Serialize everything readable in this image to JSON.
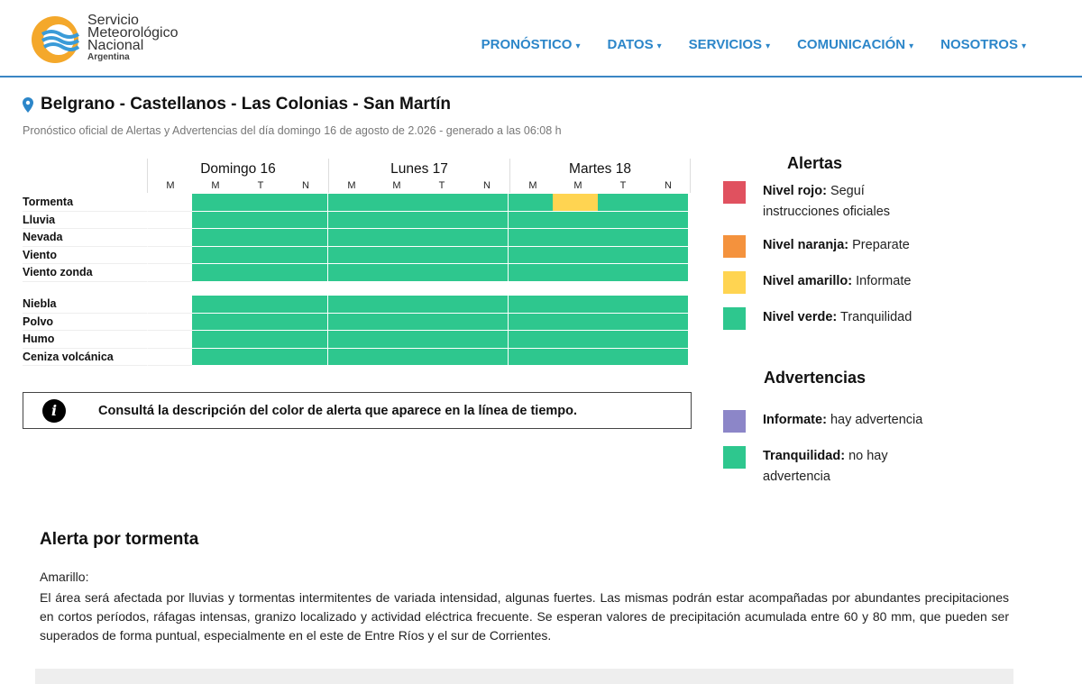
{
  "brand": {
    "line1": "Servicio",
    "line2": "Meteorológico",
    "line3": "Nacional",
    "line4": "Argentina",
    "colors": {
      "orange": "#f4a82b",
      "blue": "#3a9bd8"
    }
  },
  "nav": [
    {
      "label": "PRONÓSTICO",
      "caret": "▾"
    },
    {
      "label": "DATOS",
      "caret": "▾"
    },
    {
      "label": "SERVICIOS",
      "caret": "▾"
    },
    {
      "label": "COMUNICACIÓN",
      "caret": "▾"
    },
    {
      "label": "NOSOTROS",
      "caret": "▾"
    }
  ],
  "location": {
    "icon": "map-pin-icon",
    "title": "Belgrano - Castellanos - Las Colonias - San Martín",
    "subtitle": "Pronóstico oficial de Alertas y Advertencias del día domingo 16 de agosto de 2.026 - generado a las 06:08 h"
  },
  "timeline": {
    "days": [
      {
        "name": "Domingo 16",
        "periods": [
          "M",
          "M",
          "T",
          "N"
        ]
      },
      {
        "name": "Lunes 17",
        "periods": [
          "M",
          "M",
          "T",
          "N"
        ]
      },
      {
        "name": "Martes 18",
        "periods": [
          "M",
          "M",
          "T",
          "N"
        ]
      }
    ],
    "alert_rows": [
      {
        "label": "Tormenta",
        "levels": [
          "none",
          "verde",
          "verde",
          "verde",
          "verde",
          "verde",
          "verde",
          "verde",
          "verde",
          "amarillo",
          "verde",
          "verde"
        ]
      },
      {
        "label": "Lluvia",
        "levels": [
          "none",
          "verde",
          "verde",
          "verde",
          "verde",
          "verde",
          "verde",
          "verde",
          "verde",
          "verde",
          "verde",
          "verde"
        ]
      },
      {
        "label": "Nevada",
        "levels": [
          "none",
          "verde",
          "verde",
          "verde",
          "verde",
          "verde",
          "verde",
          "verde",
          "verde",
          "verde",
          "verde",
          "verde"
        ]
      },
      {
        "label": "Viento",
        "levels": [
          "none",
          "verde",
          "verde",
          "verde",
          "verde",
          "verde",
          "verde",
          "verde",
          "verde",
          "verde",
          "verde",
          "verde"
        ]
      },
      {
        "label": "Viento zonda",
        "levels": [
          "none",
          "verde",
          "verde",
          "verde",
          "verde",
          "verde",
          "verde",
          "verde",
          "verde",
          "verde",
          "verde",
          "verde"
        ]
      }
    ],
    "warning_rows": [
      {
        "label": "Niebla",
        "levels": [
          "none",
          "verde",
          "verde",
          "verde",
          "verde",
          "verde",
          "verde",
          "verde",
          "verde",
          "verde",
          "verde",
          "verde"
        ]
      },
      {
        "label": "Polvo",
        "levels": [
          "none",
          "verde",
          "verde",
          "verde",
          "verde",
          "verde",
          "verde",
          "verde",
          "verde",
          "verde",
          "verde",
          "verde"
        ]
      },
      {
        "label": "Humo",
        "levels": [
          "none",
          "verde",
          "verde",
          "verde",
          "verde",
          "verde",
          "verde",
          "verde",
          "verde",
          "verde",
          "verde",
          "verde"
        ]
      },
      {
        "label": "Ceniza volcánica",
        "levels": [
          "none",
          "verde",
          "verde",
          "verde",
          "verde",
          "verde",
          "verde",
          "verde",
          "verde",
          "verde",
          "verde",
          "verde"
        ]
      }
    ]
  },
  "info": {
    "icon": "info-icon",
    "glyph": "i",
    "text": "Consultá la descripción del color de alerta que aparece en la línea de tiempo."
  },
  "legend": {
    "alerts_title": "Alertas",
    "alerts": [
      {
        "name": "Nivel rojo:",
        "desc": "Seguí instrucciones oficiales",
        "color": "#e0515f"
      },
      {
        "name": "Nivel naranja:",
        "desc": "Preparate",
        "color": "#f4923d"
      },
      {
        "name": "Nivel amarillo:",
        "desc": "Informate",
        "color": "#ffd451"
      },
      {
        "name": "Nivel verde:",
        "desc": "Tranquilidad",
        "color": "#2ec78e"
      }
    ],
    "warnings_title": "Advertencias",
    "warnings": [
      {
        "name": "Informate:",
        "desc": "hay advertencia",
        "color": "#8c86c8"
      },
      {
        "name": "Tranquilidad:",
        "desc": "no hay advertencia",
        "color": "#2ec78e"
      }
    ]
  },
  "alert_detail": {
    "title": "Alerta por tormenta",
    "level": "Amarillo:",
    "description": "El área será afectada por lluvias y tormentas intermitentes de variada intensidad, algunas fuertes. Las mismas podrán estar acompañadas por abundantes precipitaciones en cortos períodos, ráfagas intensas, granizo localizado y actividad eléctrica frecuente. Se esperan valores de precipitación acumulada entre 60 y 80 mm, que pueden ser superados de forma puntual, especialmente en el este de Entre Ríos y el sur de Corrientes."
  }
}
